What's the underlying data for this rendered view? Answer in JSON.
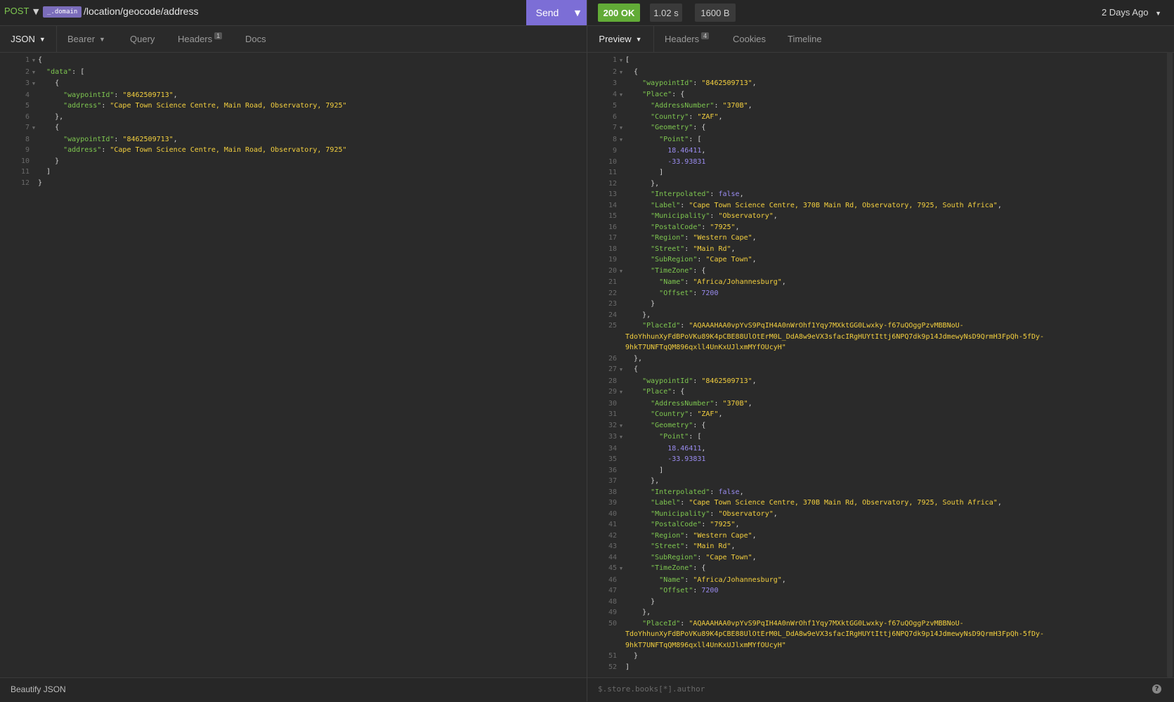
{
  "request": {
    "method": "POST",
    "domain_tag": "_.domain",
    "url_path": "/location/geocode/address",
    "send_label": "Send"
  },
  "response_meta": {
    "status": "200 OK",
    "time": "1.02 s",
    "size": "1600 B",
    "history": "2 Days Ago"
  },
  "request_tabs": {
    "body": "JSON",
    "auth": "Bearer",
    "query": "Query",
    "headers": "Headers",
    "headers_count": "1",
    "docs": "Docs"
  },
  "response_tabs": {
    "preview": "Preview",
    "headers": "Headers",
    "headers_count": "4",
    "cookies": "Cookies",
    "timeline": "Timeline"
  },
  "footer": {
    "beautify": "Beautify JSON",
    "filter_placeholder": "$.store.books[*].author"
  },
  "colors": {
    "key": "#7ec750",
    "string": "#f4d03f",
    "number": "#9a8cf0",
    "accent": "#7c6ed6",
    "ok": "#62ab37"
  },
  "icons": [
    "chevron-down-icon",
    "help-icon"
  ],
  "request_body_lines": [
    [
      [
        "p",
        "{"
      ]
    ],
    [
      [
        "p",
        "  "
      ],
      [
        "k",
        "\"data\""
      ],
      [
        "p",
        ": ["
      ]
    ],
    [
      [
        "p",
        "    {"
      ]
    ],
    [
      [
        "p",
        "      "
      ],
      [
        "k",
        "\"waypointId\""
      ],
      [
        "p",
        ": "
      ],
      [
        "s",
        "\"8462509713\""
      ],
      [
        "p",
        ","
      ]
    ],
    [
      [
        "p",
        "      "
      ],
      [
        "k",
        "\"address\""
      ],
      [
        "p",
        ": "
      ],
      [
        "s",
        "\"Cape Town Science Centre, Main Road, Observatory, 7925\""
      ]
    ],
    [
      [
        "p",
        "    },"
      ]
    ],
    [
      [
        "p",
        "    {"
      ]
    ],
    [
      [
        "p",
        "      "
      ],
      [
        "k",
        "\"waypointId\""
      ],
      [
        "p",
        ": "
      ],
      [
        "s",
        "\"8462509713\""
      ],
      [
        "p",
        ","
      ]
    ],
    [
      [
        "p",
        "      "
      ],
      [
        "k",
        "\"address\""
      ],
      [
        "p",
        ": "
      ],
      [
        "s",
        "\"Cape Town Science Centre, Main Road, Observatory, 7925\""
      ]
    ],
    [
      [
        "p",
        "    }"
      ]
    ],
    [
      [
        "p",
        "  ]"
      ]
    ],
    [
      [
        "p",
        "}"
      ]
    ]
  ],
  "request_folds": [
    1,
    2,
    3,
    7
  ],
  "response_body_lines": [
    [
      [
        "p",
        "["
      ]
    ],
    [
      [
        "p",
        "  {"
      ]
    ],
    [
      [
        "p",
        "    "
      ],
      [
        "k",
        "\"waypointId\""
      ],
      [
        "p",
        ": "
      ],
      [
        "s",
        "\"8462509713\""
      ],
      [
        "p",
        ","
      ]
    ],
    [
      [
        "p",
        "    "
      ],
      [
        "k",
        "\"Place\""
      ],
      [
        "p",
        ": {"
      ]
    ],
    [
      [
        "p",
        "      "
      ],
      [
        "k",
        "\"AddressNumber\""
      ],
      [
        "p",
        ": "
      ],
      [
        "s",
        "\"370B\""
      ],
      [
        "p",
        ","
      ]
    ],
    [
      [
        "p",
        "      "
      ],
      [
        "k",
        "\"Country\""
      ],
      [
        "p",
        ": "
      ],
      [
        "s",
        "\"ZAF\""
      ],
      [
        "p",
        ","
      ]
    ],
    [
      [
        "p",
        "      "
      ],
      [
        "k",
        "\"Geometry\""
      ],
      [
        "p",
        ": {"
      ]
    ],
    [
      [
        "p",
        "        "
      ],
      [
        "k",
        "\"Point\""
      ],
      [
        "p",
        ": ["
      ]
    ],
    [
      [
        "p",
        "          "
      ],
      [
        "n",
        "18.46411"
      ],
      [
        "p",
        ","
      ]
    ],
    [
      [
        "p",
        "          "
      ],
      [
        "n",
        "-33.93831"
      ]
    ],
    [
      [
        "p",
        "        ]"
      ]
    ],
    [
      [
        "p",
        "      },"
      ]
    ],
    [
      [
        "p",
        "      "
      ],
      [
        "k",
        "\"Interpolated\""
      ],
      [
        "p",
        ": "
      ],
      [
        "b",
        "false"
      ],
      [
        "p",
        ","
      ]
    ],
    [
      [
        "p",
        "      "
      ],
      [
        "k",
        "\"Label\""
      ],
      [
        "p",
        ": "
      ],
      [
        "s",
        "\"Cape Town Science Centre, 370B Main Rd, Observatory, 7925, South Africa\""
      ],
      [
        "p",
        ","
      ]
    ],
    [
      [
        "p",
        "      "
      ],
      [
        "k",
        "\"Municipality\""
      ],
      [
        "p",
        ": "
      ],
      [
        "s",
        "\"Observatory\""
      ],
      [
        "p",
        ","
      ]
    ],
    [
      [
        "p",
        "      "
      ],
      [
        "k",
        "\"PostalCode\""
      ],
      [
        "p",
        ": "
      ],
      [
        "s",
        "\"7925\""
      ],
      [
        "p",
        ","
      ]
    ],
    [
      [
        "p",
        "      "
      ],
      [
        "k",
        "\"Region\""
      ],
      [
        "p",
        ": "
      ],
      [
        "s",
        "\"Western Cape\""
      ],
      [
        "p",
        ","
      ]
    ],
    [
      [
        "p",
        "      "
      ],
      [
        "k",
        "\"Street\""
      ],
      [
        "p",
        ": "
      ],
      [
        "s",
        "\"Main Rd\""
      ],
      [
        "p",
        ","
      ]
    ],
    [
      [
        "p",
        "      "
      ],
      [
        "k",
        "\"SubRegion\""
      ],
      [
        "p",
        ": "
      ],
      [
        "s",
        "\"Cape Town\""
      ],
      [
        "p",
        ","
      ]
    ],
    [
      [
        "p",
        "      "
      ],
      [
        "k",
        "\"TimeZone\""
      ],
      [
        "p",
        ": {"
      ]
    ],
    [
      [
        "p",
        "        "
      ],
      [
        "k",
        "\"Name\""
      ],
      [
        "p",
        ": "
      ],
      [
        "s",
        "\"Africa/Johannesburg\""
      ],
      [
        "p",
        ","
      ]
    ],
    [
      [
        "p",
        "        "
      ],
      [
        "k",
        "\"Offset\""
      ],
      [
        "p",
        ": "
      ],
      [
        "n",
        "7200"
      ]
    ],
    [
      [
        "p",
        "      }"
      ]
    ],
    [
      [
        "p",
        "    },"
      ]
    ],
    [
      [
        "p",
        "    "
      ],
      [
        "k",
        "\"PlaceId\""
      ],
      [
        "p",
        ": "
      ],
      [
        "s",
        "\"AQAAAHAA0vpYvS9PqIH4A0nWrOhf1Yqy7MXktGG0Lwxky-f67uQOggPzvMBBNoU-"
      ]
    ],
    [
      [
        "s",
        "TdoYhhunXyFdBPoVKu89K4pCBE88UlOtErM0L_DdA8w9eVX3sfacIRgHUYtIttj6NPQ7dk9p14JdmewyNsD9QrmH3FpQh-5fDy-"
      ]
    ],
    [
      [
        "s",
        "9hkT7UNFTqQM896qxll4UnKxUJlxmMYfOUcyH\""
      ]
    ],
    [
      [
        "p",
        "  },"
      ]
    ],
    [
      [
        "p",
        "  {"
      ]
    ],
    [
      [
        "p",
        "    "
      ],
      [
        "k",
        "\"waypointId\""
      ],
      [
        "p",
        ": "
      ],
      [
        "s",
        "\"8462509713\""
      ],
      [
        "p",
        ","
      ]
    ],
    [
      [
        "p",
        "    "
      ],
      [
        "k",
        "\"Place\""
      ],
      [
        "p",
        ": {"
      ]
    ],
    [
      [
        "p",
        "      "
      ],
      [
        "k",
        "\"AddressNumber\""
      ],
      [
        "p",
        ": "
      ],
      [
        "s",
        "\"370B\""
      ],
      [
        "p",
        ","
      ]
    ],
    [
      [
        "p",
        "      "
      ],
      [
        "k",
        "\"Country\""
      ],
      [
        "p",
        ": "
      ],
      [
        "s",
        "\"ZAF\""
      ],
      [
        "p",
        ","
      ]
    ],
    [
      [
        "p",
        "      "
      ],
      [
        "k",
        "\"Geometry\""
      ],
      [
        "p",
        ": {"
      ]
    ],
    [
      [
        "p",
        "        "
      ],
      [
        "k",
        "\"Point\""
      ],
      [
        "p",
        ": ["
      ]
    ],
    [
      [
        "p",
        "          "
      ],
      [
        "n",
        "18.46411"
      ],
      [
        "p",
        ","
      ]
    ],
    [
      [
        "p",
        "          "
      ],
      [
        "n",
        "-33.93831"
      ]
    ],
    [
      [
        "p",
        "        ]"
      ]
    ],
    [
      [
        "p",
        "      },"
      ]
    ],
    [
      [
        "p",
        "      "
      ],
      [
        "k",
        "\"Interpolated\""
      ],
      [
        "p",
        ": "
      ],
      [
        "b",
        "false"
      ],
      [
        "p",
        ","
      ]
    ],
    [
      [
        "p",
        "      "
      ],
      [
        "k",
        "\"Label\""
      ],
      [
        "p",
        ": "
      ],
      [
        "s",
        "\"Cape Town Science Centre, 370B Main Rd, Observatory, 7925, South Africa\""
      ],
      [
        "p",
        ","
      ]
    ],
    [
      [
        "p",
        "      "
      ],
      [
        "k",
        "\"Municipality\""
      ],
      [
        "p",
        ": "
      ],
      [
        "s",
        "\"Observatory\""
      ],
      [
        "p",
        ","
      ]
    ],
    [
      [
        "p",
        "      "
      ],
      [
        "k",
        "\"PostalCode\""
      ],
      [
        "p",
        ": "
      ],
      [
        "s",
        "\"7925\""
      ],
      [
        "p",
        ","
      ]
    ],
    [
      [
        "p",
        "      "
      ],
      [
        "k",
        "\"Region\""
      ],
      [
        "p",
        ": "
      ],
      [
        "s",
        "\"Western Cape\""
      ],
      [
        "p",
        ","
      ]
    ],
    [
      [
        "p",
        "      "
      ],
      [
        "k",
        "\"Street\""
      ],
      [
        "p",
        ": "
      ],
      [
        "s",
        "\"Main Rd\""
      ],
      [
        "p",
        ","
      ]
    ],
    [
      [
        "p",
        "      "
      ],
      [
        "k",
        "\"SubRegion\""
      ],
      [
        "p",
        ": "
      ],
      [
        "s",
        "\"Cape Town\""
      ],
      [
        "p",
        ","
      ]
    ],
    [
      [
        "p",
        "      "
      ],
      [
        "k",
        "\"TimeZone\""
      ],
      [
        "p",
        ": {"
      ]
    ],
    [
      [
        "p",
        "        "
      ],
      [
        "k",
        "\"Name\""
      ],
      [
        "p",
        ": "
      ],
      [
        "s",
        "\"Africa/Johannesburg\""
      ],
      [
        "p",
        ","
      ]
    ],
    [
      [
        "p",
        "        "
      ],
      [
        "k",
        "\"Offset\""
      ],
      [
        "p",
        ": "
      ],
      [
        "n",
        "7200"
      ]
    ],
    [
      [
        "p",
        "      }"
      ]
    ],
    [
      [
        "p",
        "    },"
      ]
    ],
    [
      [
        "p",
        "    "
      ],
      [
        "k",
        "\"PlaceId\""
      ],
      [
        "p",
        ": "
      ],
      [
        "s",
        "\"AQAAAHAA0vpYvS9PqIH4A0nWrOhf1Yqy7MXktGG0Lwxky-f67uQOggPzvMBBNoU-"
      ]
    ],
    [
      [
        "s",
        "TdoYhhunXyFdBPoVKu89K4pCBE88UlOtErM0L_DdA8w9eVX3sfacIRgHUYtIttj6NPQ7dk9p14JdmewyNsD9QrmH3FpQh-5fDy-"
      ]
    ],
    [
      [
        "s",
        "9hkT7UNFTqQM896qxll4UnKxUJlxmMYfOUcyH\""
      ]
    ],
    [
      [
        "p",
        "  }"
      ]
    ],
    [
      [
        "p",
        "]"
      ]
    ]
  ],
  "response_line_numbers": [
    1,
    2,
    3,
    4,
    5,
    6,
    7,
    8,
    9,
    10,
    11,
    12,
    13,
    14,
    15,
    16,
    17,
    18,
    19,
    20,
    21,
    22,
    23,
    24,
    25,
    "",
    "",
    26,
    27,
    28,
    29,
    30,
    31,
    32,
    33,
    34,
    35,
    36,
    37,
    38,
    39,
    40,
    41,
    42,
    43,
    44,
    45,
    46,
    47,
    48,
    49,
    50,
    "",
    "",
    51,
    52
  ],
  "response_folds": [
    1,
    2,
    4,
    7,
    8,
    20,
    27,
    29,
    32,
    33,
    45
  ]
}
